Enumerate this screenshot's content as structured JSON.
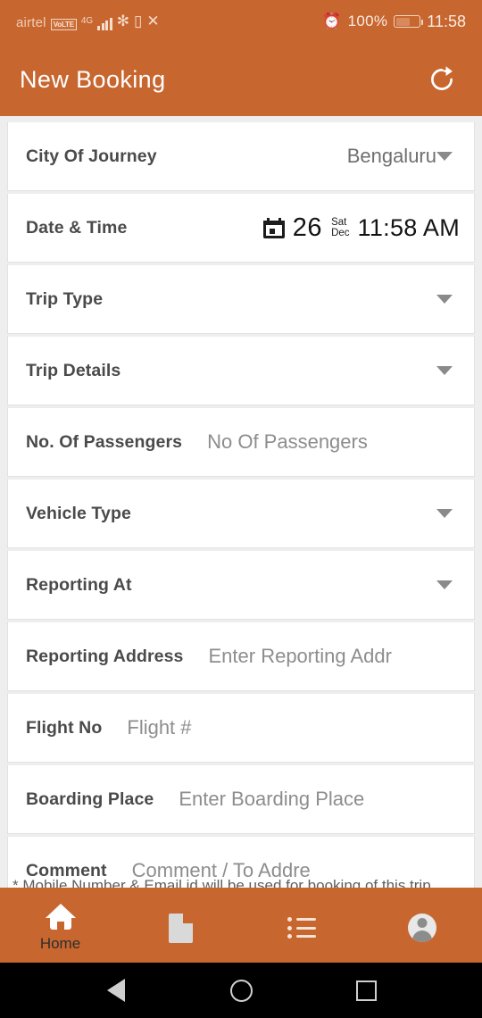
{
  "statusbar": {
    "carrier": "airtel",
    "volte_badge": "VoLTE",
    "network_generation": "4G",
    "icons": [
      "signal-bars-icon",
      "bluetooth-icon",
      "vibrate-icon",
      "missed-call-icon",
      "alarm-icon",
      "battery-icon"
    ],
    "bluetooth_glyph": "✻",
    "vibrate_glyph": "▯",
    "missed_call_glyph": "✕",
    "alarm_glyph": "⏰",
    "battery_percent": "100%",
    "clock": "11:58"
  },
  "appbar": {
    "title": "New Booking",
    "refresh_label": "refresh"
  },
  "theme": {
    "accent": "#c8662f",
    "page_bg": "#eeeeee",
    "card_bg": "#ffffff",
    "label_color": "#4a4a4a",
    "placeholder_color": "#8d8d8d"
  },
  "form": {
    "rows": [
      {
        "label": "City Of Journey",
        "type": "dropdown",
        "value": "Bengaluru",
        "placeholder": ""
      },
      {
        "label": "Date & Time",
        "type": "datetime",
        "day": "26",
        "weekday": "Sat",
        "month": "Dec",
        "time": "11:58 AM"
      },
      {
        "label": "Trip Type",
        "type": "dropdown",
        "value": "",
        "placeholder": ""
      },
      {
        "label": "Trip Details",
        "type": "dropdown",
        "value": "",
        "placeholder": ""
      },
      {
        "label": "No. Of Passengers",
        "type": "text",
        "value": "",
        "placeholder": "No Of Passengers"
      },
      {
        "label": "Vehicle Type",
        "type": "dropdown",
        "value": "",
        "placeholder": ""
      },
      {
        "label": "Reporting At",
        "type": "dropdown",
        "value": "",
        "placeholder": ""
      },
      {
        "label": "Reporting Address",
        "type": "text",
        "value": "",
        "placeholder": "Enter Reporting Addr"
      },
      {
        "label": "Flight No",
        "type": "text",
        "value": "",
        "placeholder": "Flight #"
      },
      {
        "label": "Boarding Place",
        "type": "text",
        "value": "",
        "placeholder": "Enter Boarding Place"
      },
      {
        "label": "Comment",
        "type": "text",
        "value": "",
        "placeholder": "Comment / To Addre"
      }
    ],
    "footer_note": "* Mobile Number & Email id will be used for booking of this trip"
  },
  "bottomnav": {
    "items": [
      {
        "icon": "home-icon",
        "label": "Home",
        "active": true
      },
      {
        "icon": "document-icon",
        "label": "",
        "active": false
      },
      {
        "icon": "list-icon",
        "label": "",
        "active": false
      },
      {
        "icon": "account-icon",
        "label": "",
        "active": false
      }
    ]
  },
  "systembar": {
    "back": "back-icon",
    "home": "home-circle-icon",
    "recents": "recents-square-icon"
  }
}
